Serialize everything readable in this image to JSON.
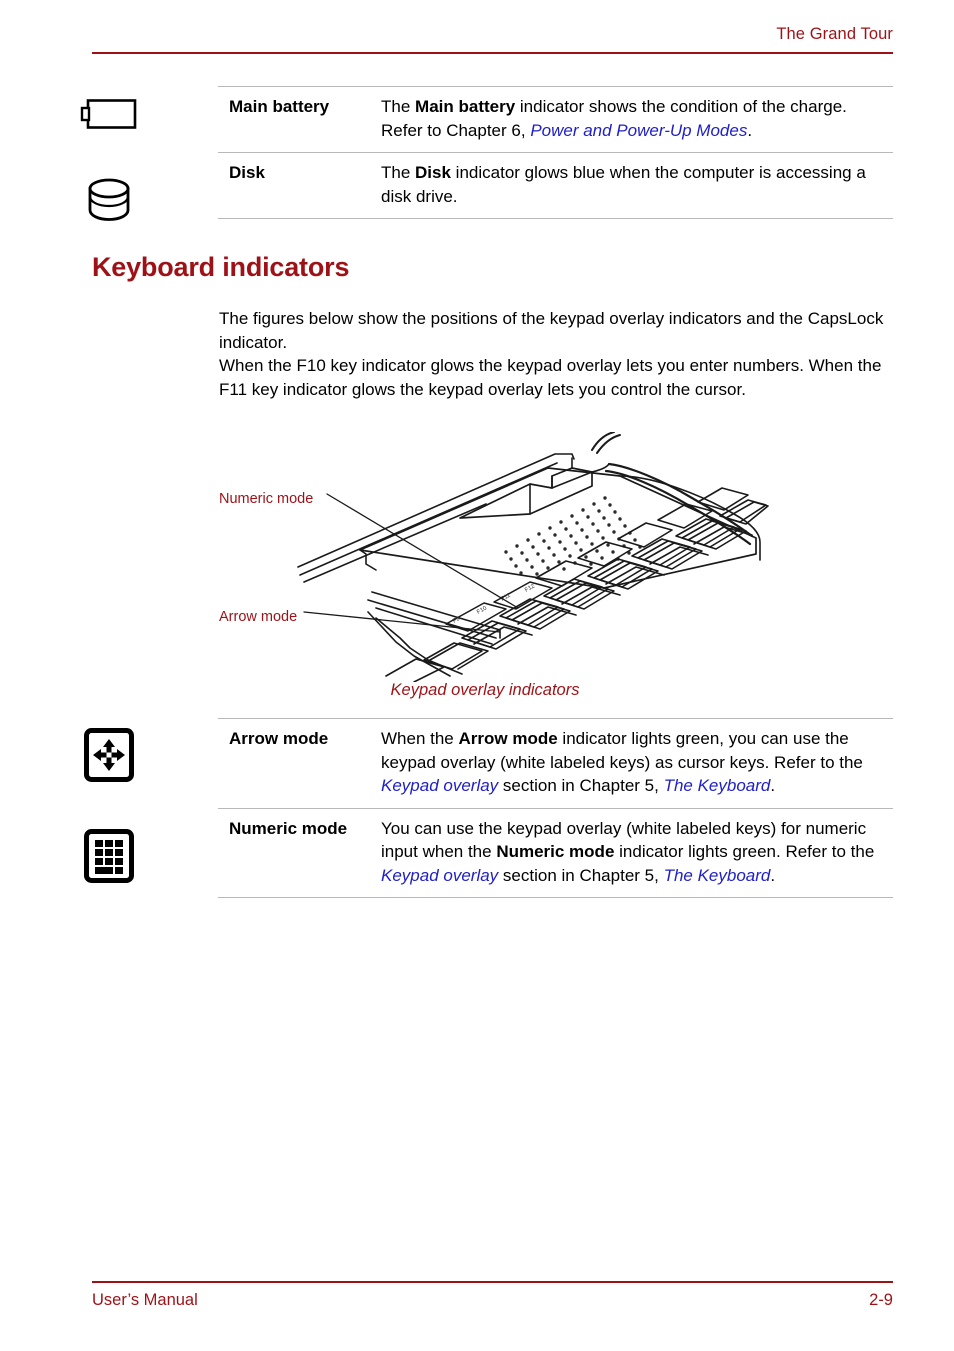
{
  "header": {
    "title": "The Grand Tour"
  },
  "footer": {
    "manual_label": "User’s Manual",
    "page_number": "2-9"
  },
  "indicator_table_top": {
    "rows": [
      {
        "icon": "battery-icon",
        "term": "Main battery",
        "desc_parts": [
          {
            "text": "The ",
            "style": "normal"
          },
          {
            "text": "Main battery",
            "style": "bold"
          },
          {
            "text": " indicator shows the condition of the charge. Refer to Chapter 6, ",
            "style": "normal"
          },
          {
            "text": "Power and Power-Up Modes",
            "style": "link"
          },
          {
            "text": ".",
            "style": "normal"
          }
        ]
      },
      {
        "icon": "disk-icon",
        "term": "Disk",
        "desc_parts": [
          {
            "text": "The ",
            "style": "normal"
          },
          {
            "text": "Disk",
            "style": "bold"
          },
          {
            "text": " indicator glows blue when the computer is accessing a disk drive.",
            "style": "normal"
          }
        ]
      }
    ]
  },
  "section": {
    "heading": "Keyboard indicators",
    "paragraphs": [
      "The figures below show the positions of the keypad overlay indicators and the CapsLock indicator.",
      "When the F10 key indicator glows the keypad overlay lets you enter numbers. When the F11 key indicator glows the keypad overlay lets you control the cursor."
    ]
  },
  "figure": {
    "label_numeric": "Numeric mode",
    "label_arrow": "Arrow mode",
    "caption": "Keypad overlay indicators",
    "alt": "Line drawing of laptop keyboard showing keypad overlay indicator lights"
  },
  "indicator_table_bottom": {
    "rows": [
      {
        "icon": "arrow-mode-icon",
        "term": "Arrow mode",
        "desc_parts": [
          {
            "text": "When the ",
            "style": "normal"
          },
          {
            "text": "Arrow mode",
            "style": "bold"
          },
          {
            "text": " indicator lights green, you can use the keypad overlay (white labeled keys) as cursor keys. Refer to the ",
            "style": "normal"
          },
          {
            "text": "Keypad overlay",
            "style": "link"
          },
          {
            "text": " section in Chapter 5, ",
            "style": "normal"
          },
          {
            "text": "The Keyboard",
            "style": "link"
          },
          {
            "text": ".",
            "style": "normal"
          }
        ]
      },
      {
        "icon": "numeric-mode-icon",
        "term": "Numeric mode",
        "desc_parts": [
          {
            "text": "You can use the keypad overlay (white labeled keys) for numeric input when the ",
            "style": "normal"
          },
          {
            "text": "Numeric mode",
            "style": "bold"
          },
          {
            "text": " indicator lights green. Refer to the ",
            "style": "normal"
          },
          {
            "text": "Keypad overlay",
            "style": "link"
          },
          {
            "text": " section in Chapter 5, ",
            "style": "normal"
          },
          {
            "text": "The Keyboard",
            "style": "link"
          },
          {
            "text": ".",
            "style": "normal"
          }
        ]
      }
    ]
  },
  "colors": {
    "accent_red": "#9e1217",
    "link_blue": "#2020c8",
    "rule_gray": "#b9b9b9",
    "text_black": "#000000"
  }
}
